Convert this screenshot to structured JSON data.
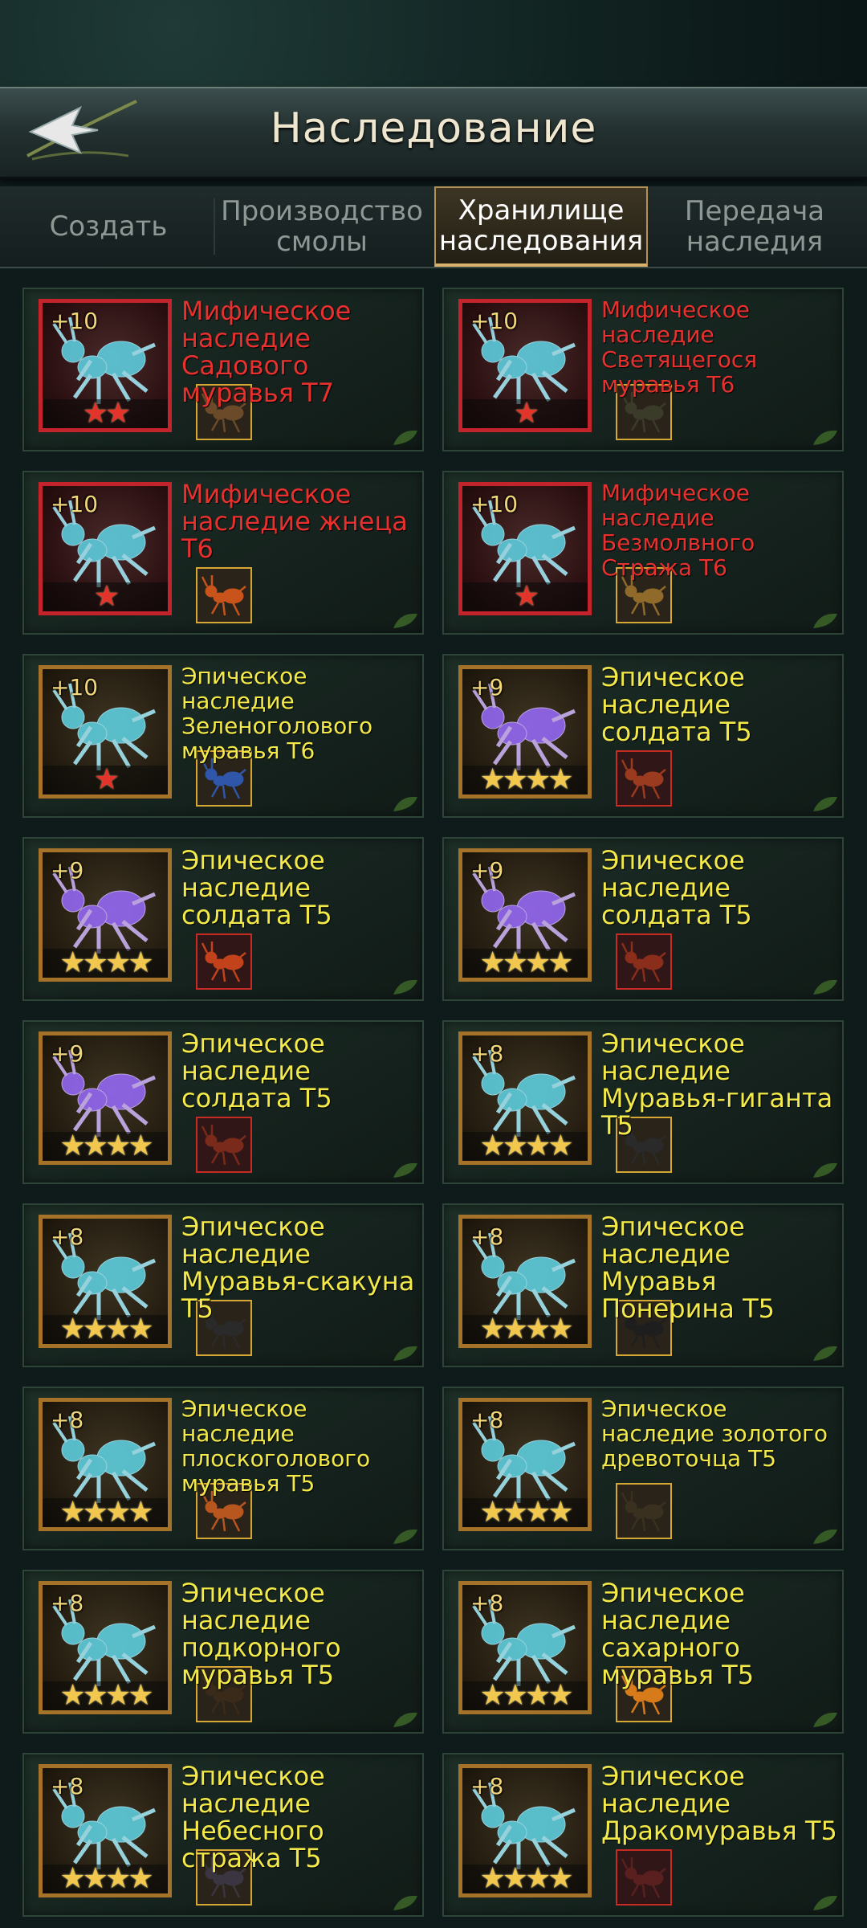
{
  "header": {
    "title": "Наследование",
    "back_icon": "back-arrow-icon"
  },
  "tabs": [
    {
      "label": "Создать",
      "active": false
    },
    {
      "label": "Производство смолы",
      "active": false
    },
    {
      "label": "Хранилище наследования",
      "active": true
    },
    {
      "label": "Передача наследия",
      "active": false
    }
  ],
  "colors": {
    "mythic": "#e8312e",
    "epic": "#f3ea4a",
    "active_tab_border": "#d9b36b"
  },
  "items": [
    {
      "level": "+10",
      "rarity": "mythic",
      "stars": "★★",
      "name": "Мифическое наследие Садового муравья Т7",
      "ant_color": "#6b4a2a"
    },
    {
      "level": "+10",
      "rarity": "mythic",
      "stars": "★",
      "name": "Мифическое наследие Светящегося муравья Т6",
      "ant_color": "#3b3b2a"
    },
    {
      "level": "+10",
      "rarity": "mythic",
      "stars": "★",
      "name": "Мифическое наследие жнеца Т6",
      "ant_color": "#c8541b"
    },
    {
      "level": "+10",
      "rarity": "mythic",
      "stars": "★",
      "name": "Мифическое наследие Безмолвного Стража Т6",
      "ant_color": "#8f6a2a"
    },
    {
      "level": "+10",
      "rarity": "epic",
      "stars": "★",
      "name": "Эпическое наследие Зеленоголового муравья Т6",
      "ant_color": "#2f56a8"
    },
    {
      "level": "+9",
      "rarity": "epic",
      "stars": "★★★★",
      "name": "Эпическое наследие солдата Т5",
      "ant_color": "#9a3a1f"
    },
    {
      "level": "+9",
      "rarity": "epic",
      "stars": "★★★★",
      "name": "Эпическое наследие солдата Т5",
      "ant_color": "#c2431b"
    },
    {
      "level": "+9",
      "rarity": "epic",
      "stars": "★★★★",
      "name": "Эпическое наследие солдата Т5",
      "ant_color": "#8a2d1a"
    },
    {
      "level": "+9",
      "rarity": "epic",
      "stars": "★★★★",
      "name": "Эпическое наследие солдата Т5",
      "ant_color": "#7a2a1a"
    },
    {
      "level": "+8",
      "rarity": "epic",
      "stars": "★★★★",
      "name": "Эпическое наследие Муравья-гиганта Т5",
      "ant_color": "#2a2a2a"
    },
    {
      "level": "+8",
      "rarity": "epic",
      "stars": "★★★★",
      "name": "Эпическое наследие Муравья-скакуна Т5",
      "ant_color": "#2a2a2a"
    },
    {
      "level": "+8",
      "rarity": "epic",
      "stars": "★★★★",
      "name": "Эпическое наследие Муравья Понерина Т5",
      "ant_color": "#1e1e1e"
    },
    {
      "level": "+8",
      "rarity": "epic",
      "stars": "★★★★",
      "name": "Эпическое наследие плоскоголового муравья Т5",
      "ant_color": "#b8561f"
    },
    {
      "level": "+8",
      "rarity": "epic",
      "stars": "★★★★",
      "name": "Эпическое наследие золотого древоточца Т5",
      "ant_color": "#3a3020"
    },
    {
      "level": "+8",
      "rarity": "epic",
      "stars": "★★★★",
      "name": "Эпическое наследие подкорного муравья Т5",
      "ant_color": "#3a2a1a"
    },
    {
      "level": "+8",
      "rarity": "epic",
      "stars": "★★★★",
      "name": "Эпическое наследие сахарного муравья Т5",
      "ant_color": "#d67a1a"
    },
    {
      "level": "+8",
      "rarity": "epic",
      "stars": "★★★★",
      "name": "Эпическое наследие Небесного стража Т5",
      "ant_color": "#3a3540"
    },
    {
      "level": "+8",
      "rarity": "epic",
      "stars": "★★★★",
      "name": "Эпическое наследие Дракомуравья Т5",
      "ant_color": "#5a2020"
    }
  ]
}
